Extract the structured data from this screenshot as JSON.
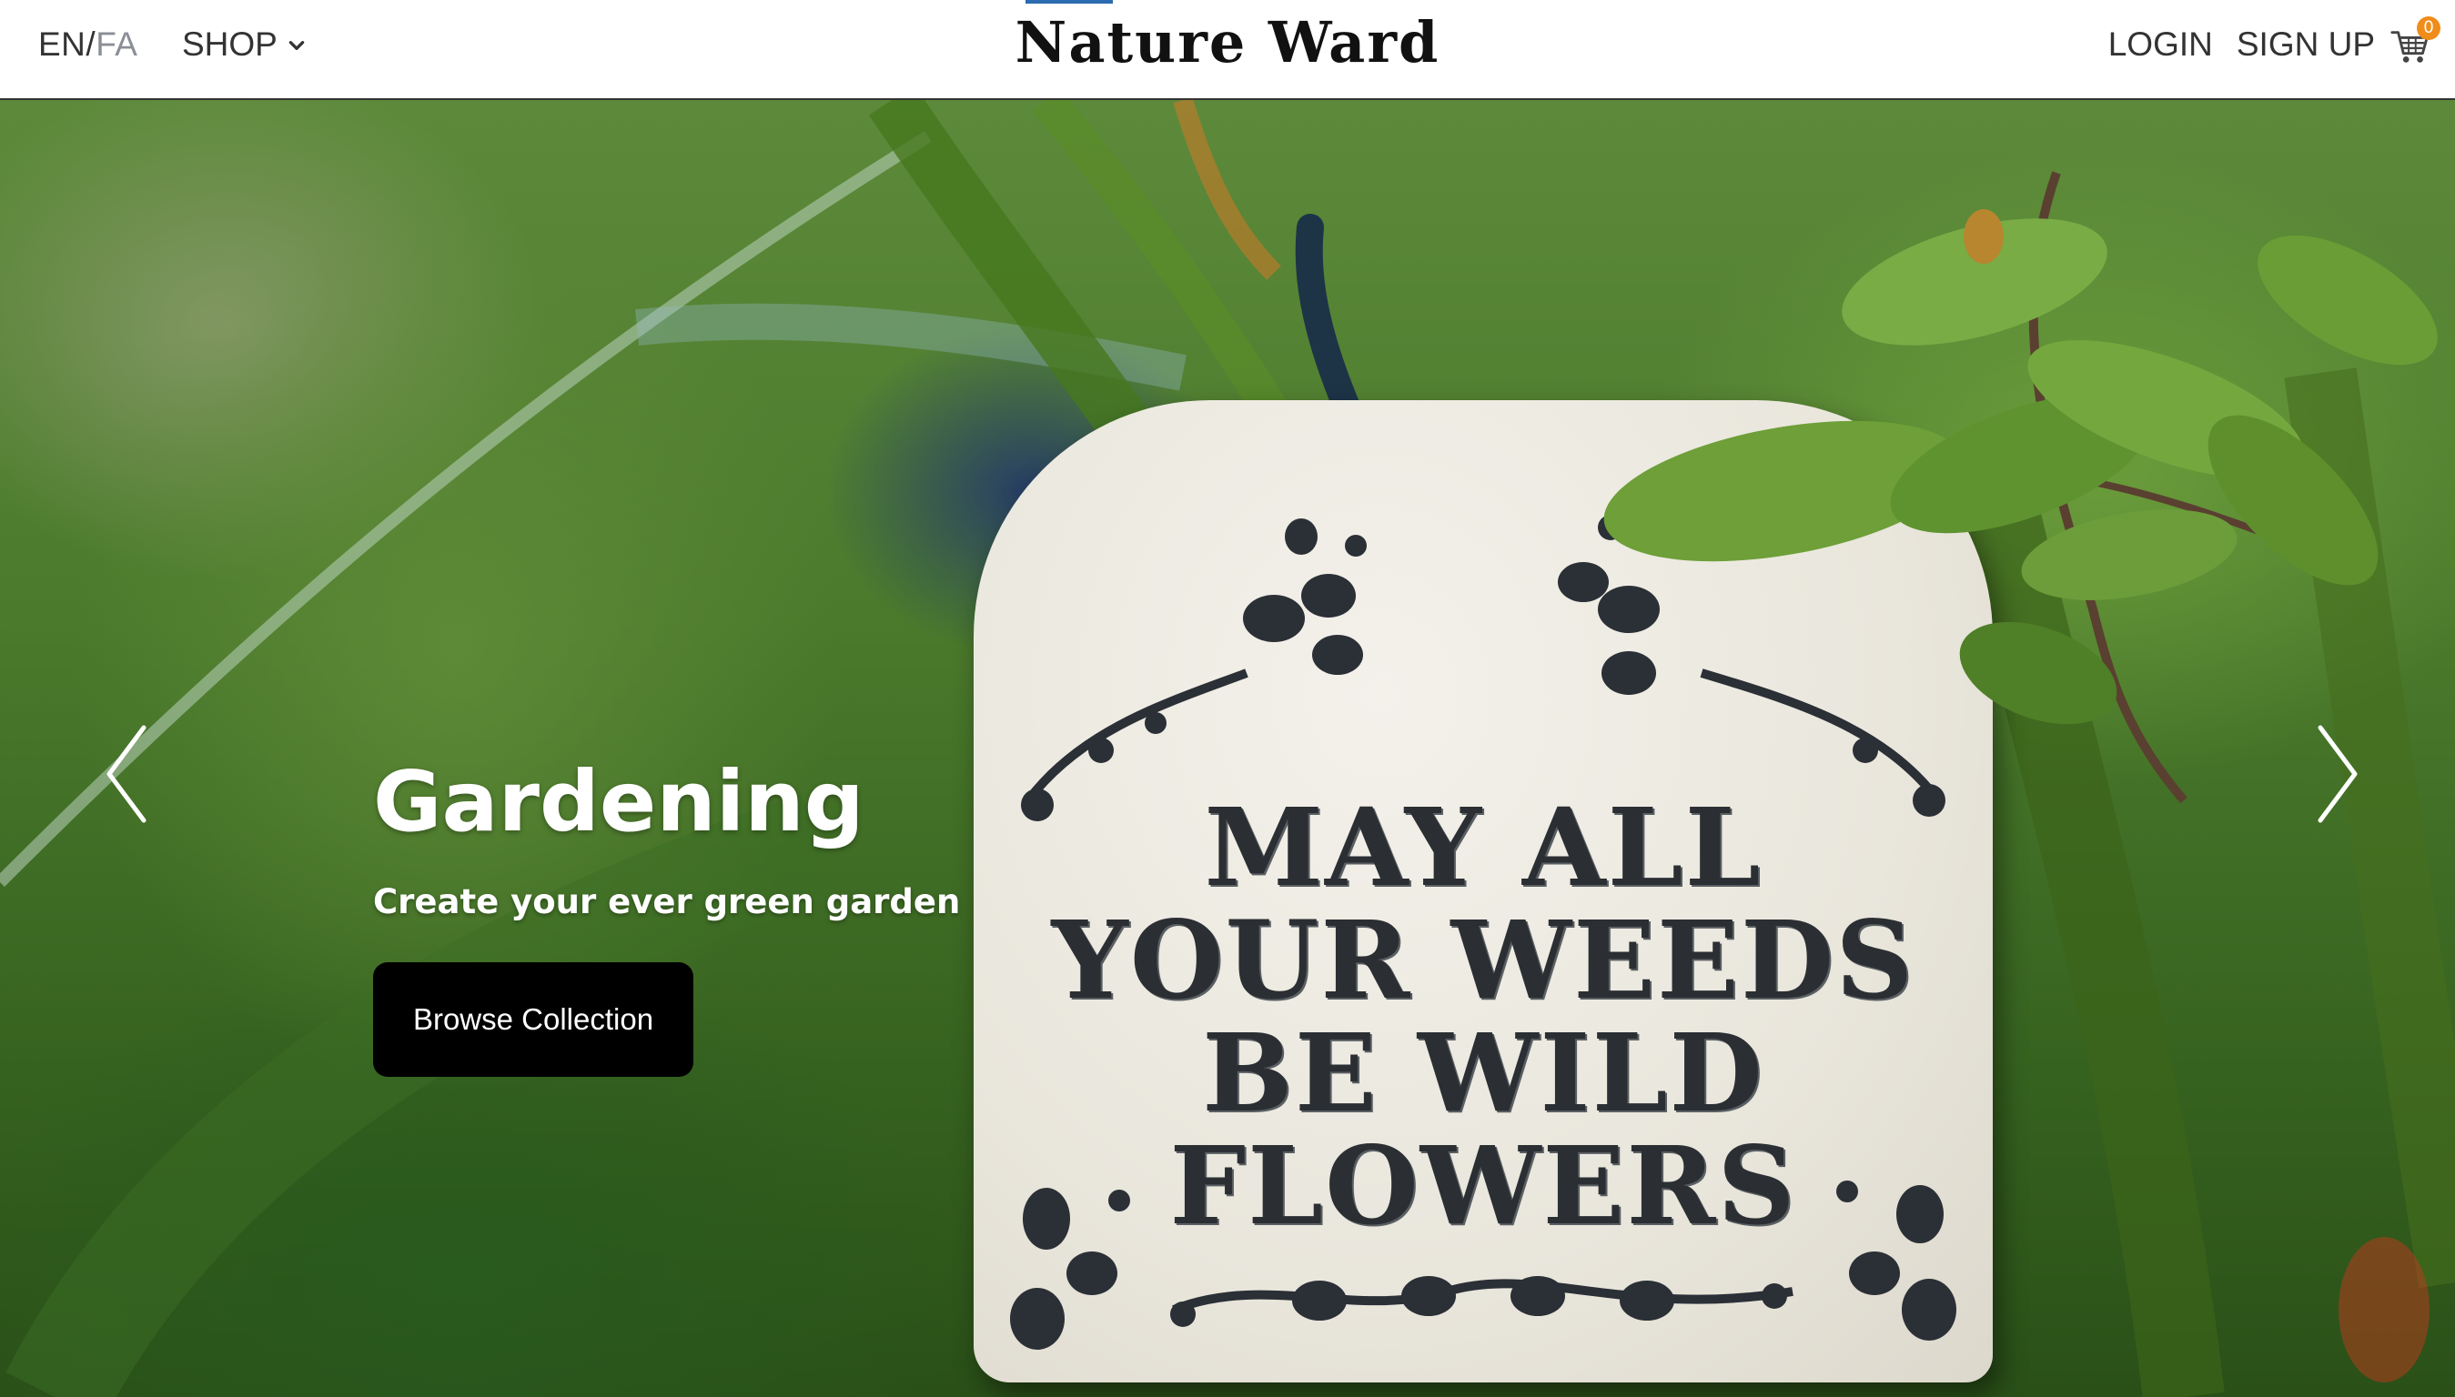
{
  "header": {
    "lang": {
      "en": "EN",
      "separator": "/",
      "fa": "FA"
    },
    "shop_label": "SHOP",
    "brand": "Nature Ward",
    "login_label": "LOGIN",
    "signup_label": "SIGN UP",
    "cart_count": "0",
    "icons": {
      "shop_caret": "chevron-down-icon",
      "cart": "cart-icon"
    }
  },
  "hero": {
    "title": "Gardening",
    "subtitle": "Create your ever green garden",
    "button_label": "Browse Collection",
    "sign_lines": [
      "MAY ALL",
      "YOUR WEEDS",
      "BE WILD",
      "FLOWERS"
    ],
    "prev_icon": "chevron-left-icon",
    "next_icon": "chevron-right-icon"
  },
  "colors": {
    "header_bg": "#ffffff",
    "button_bg": "#000000",
    "cart_badge": "#f08c1a",
    "brand_accent": "#2b6cb0"
  }
}
